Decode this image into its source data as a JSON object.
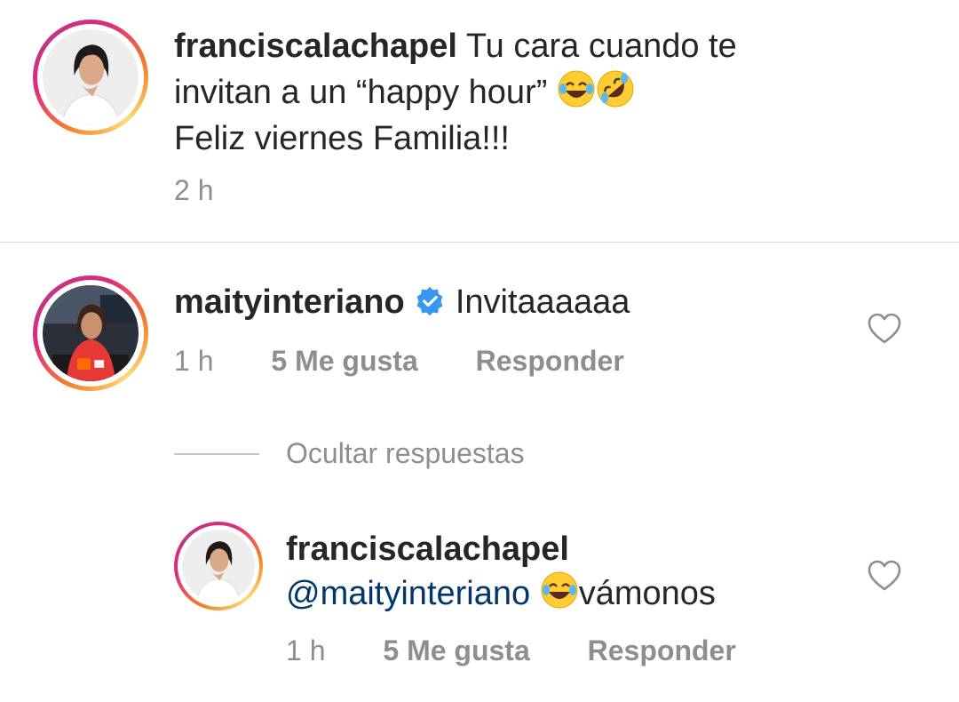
{
  "post": {
    "username": "franciscalachapel",
    "caption_line1": "Tu cara cuando te",
    "caption_line2": "invitan a un “happy hour”",
    "caption_line3": "Feliz viernes Familia!!!",
    "caption_emojis": [
      "face-with-tears-of-joy",
      "rolling-on-floor-laughing"
    ],
    "time": "2 h"
  },
  "comments": [
    {
      "username": "maityinteriano",
      "verified": true,
      "text": "Invitaaaaaa",
      "time": "1 h",
      "likes": "5 Me gusta",
      "reply_label": "Responder"
    }
  ],
  "replies_toggle": "Ocultar respuestas",
  "reply": {
    "username": "franciscalachapel",
    "mention": "@maityinteriano",
    "emoji": "face-with-tears-of-joy",
    "text": "vámonos",
    "time": "1 h",
    "likes": "5 Me gusta",
    "reply_label": "Responder"
  },
  "colors": {
    "text": "#262626",
    "meta": "#8e8e8e",
    "mention": "#00376b",
    "verified": "#3897f0",
    "divider": "#dbdbdb"
  }
}
